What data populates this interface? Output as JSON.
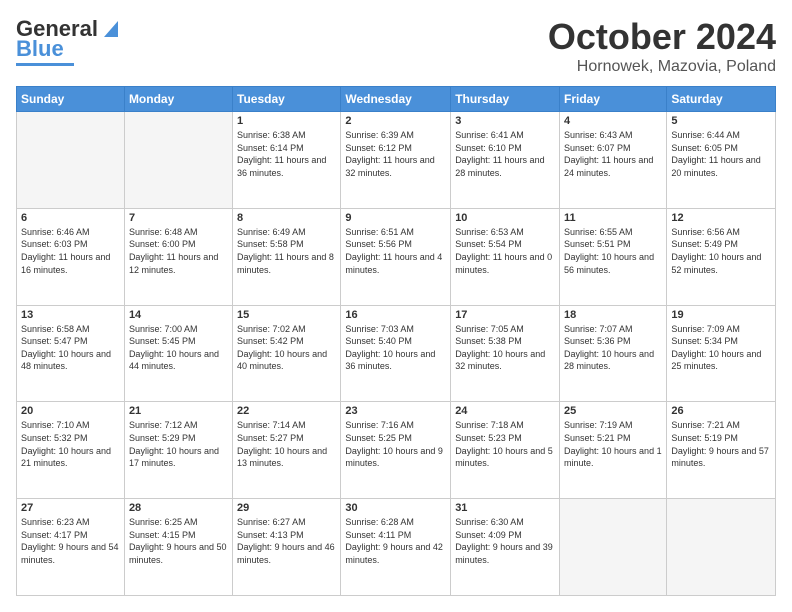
{
  "header": {
    "logo_general": "General",
    "logo_blue": "Blue",
    "month": "October 2024",
    "location": "Hornowek, Mazovia, Poland"
  },
  "days_of_week": [
    "Sunday",
    "Monday",
    "Tuesday",
    "Wednesday",
    "Thursday",
    "Friday",
    "Saturday"
  ],
  "weeks": [
    [
      {
        "day": "",
        "empty": true
      },
      {
        "day": "",
        "empty": true
      },
      {
        "day": "1",
        "sunrise": "6:38 AM",
        "sunset": "6:14 PM",
        "daylight": "11 hours and 36 minutes."
      },
      {
        "day": "2",
        "sunrise": "6:39 AM",
        "sunset": "6:12 PM",
        "daylight": "11 hours and 32 minutes."
      },
      {
        "day": "3",
        "sunrise": "6:41 AM",
        "sunset": "6:10 PM",
        "daylight": "11 hours and 28 minutes."
      },
      {
        "day": "4",
        "sunrise": "6:43 AM",
        "sunset": "6:07 PM",
        "daylight": "11 hours and 24 minutes."
      },
      {
        "day": "5",
        "sunrise": "6:44 AM",
        "sunset": "6:05 PM",
        "daylight": "11 hours and 20 minutes."
      }
    ],
    [
      {
        "day": "6",
        "sunrise": "6:46 AM",
        "sunset": "6:03 PM",
        "daylight": "11 hours and 16 minutes."
      },
      {
        "day": "7",
        "sunrise": "6:48 AM",
        "sunset": "6:00 PM",
        "daylight": "11 hours and 12 minutes."
      },
      {
        "day": "8",
        "sunrise": "6:49 AM",
        "sunset": "5:58 PM",
        "daylight": "11 hours and 8 minutes."
      },
      {
        "day": "9",
        "sunrise": "6:51 AM",
        "sunset": "5:56 PM",
        "daylight": "11 hours and 4 minutes."
      },
      {
        "day": "10",
        "sunrise": "6:53 AM",
        "sunset": "5:54 PM",
        "daylight": "11 hours and 0 minutes."
      },
      {
        "day": "11",
        "sunrise": "6:55 AM",
        "sunset": "5:51 PM",
        "daylight": "10 hours and 56 minutes."
      },
      {
        "day": "12",
        "sunrise": "6:56 AM",
        "sunset": "5:49 PM",
        "daylight": "10 hours and 52 minutes."
      }
    ],
    [
      {
        "day": "13",
        "sunrise": "6:58 AM",
        "sunset": "5:47 PM",
        "daylight": "10 hours and 48 minutes."
      },
      {
        "day": "14",
        "sunrise": "7:00 AM",
        "sunset": "5:45 PM",
        "daylight": "10 hours and 44 minutes."
      },
      {
        "day": "15",
        "sunrise": "7:02 AM",
        "sunset": "5:42 PM",
        "daylight": "10 hours and 40 minutes."
      },
      {
        "day": "16",
        "sunrise": "7:03 AM",
        "sunset": "5:40 PM",
        "daylight": "10 hours and 36 minutes."
      },
      {
        "day": "17",
        "sunrise": "7:05 AM",
        "sunset": "5:38 PM",
        "daylight": "10 hours and 32 minutes."
      },
      {
        "day": "18",
        "sunrise": "7:07 AM",
        "sunset": "5:36 PM",
        "daylight": "10 hours and 28 minutes."
      },
      {
        "day": "19",
        "sunrise": "7:09 AM",
        "sunset": "5:34 PM",
        "daylight": "10 hours and 25 minutes."
      }
    ],
    [
      {
        "day": "20",
        "sunrise": "7:10 AM",
        "sunset": "5:32 PM",
        "daylight": "10 hours and 21 minutes."
      },
      {
        "day": "21",
        "sunrise": "7:12 AM",
        "sunset": "5:29 PM",
        "daylight": "10 hours and 17 minutes."
      },
      {
        "day": "22",
        "sunrise": "7:14 AM",
        "sunset": "5:27 PM",
        "daylight": "10 hours and 13 minutes."
      },
      {
        "day": "23",
        "sunrise": "7:16 AM",
        "sunset": "5:25 PM",
        "daylight": "10 hours and 9 minutes."
      },
      {
        "day": "24",
        "sunrise": "7:18 AM",
        "sunset": "5:23 PM",
        "daylight": "10 hours and 5 minutes."
      },
      {
        "day": "25",
        "sunrise": "7:19 AM",
        "sunset": "5:21 PM",
        "daylight": "10 hours and 1 minute."
      },
      {
        "day": "26",
        "sunrise": "7:21 AM",
        "sunset": "5:19 PM",
        "daylight": "9 hours and 57 minutes."
      }
    ],
    [
      {
        "day": "27",
        "sunrise": "6:23 AM",
        "sunset": "4:17 PM",
        "daylight": "9 hours and 54 minutes."
      },
      {
        "day": "28",
        "sunrise": "6:25 AM",
        "sunset": "4:15 PM",
        "daylight": "9 hours and 50 minutes."
      },
      {
        "day": "29",
        "sunrise": "6:27 AM",
        "sunset": "4:13 PM",
        "daylight": "9 hours and 46 minutes."
      },
      {
        "day": "30",
        "sunrise": "6:28 AM",
        "sunset": "4:11 PM",
        "daylight": "9 hours and 42 minutes."
      },
      {
        "day": "31",
        "sunrise": "6:30 AM",
        "sunset": "4:09 PM",
        "daylight": "9 hours and 39 minutes."
      },
      {
        "day": "",
        "empty": true
      },
      {
        "day": "",
        "empty": true
      }
    ]
  ]
}
